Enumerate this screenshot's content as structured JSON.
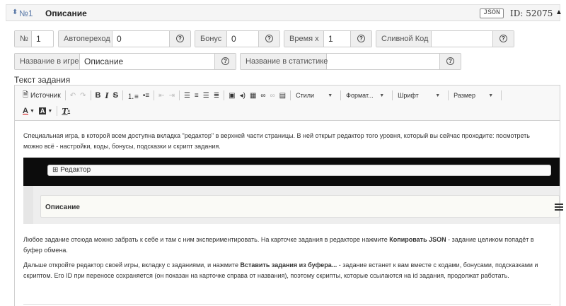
{
  "header": {
    "sort_icon": "sort-icon",
    "number": "№1",
    "title": "Описание",
    "json_badge": "JSON",
    "id_text": "ID: 52075",
    "collapse_icon": "▲"
  },
  "fields": {
    "number": {
      "label": "№",
      "value": "1"
    },
    "autotransition": {
      "label": "Автопереход",
      "value": "0"
    },
    "bonus": {
      "label": "Бонус",
      "value": "0"
    },
    "time": {
      "label": "Время х",
      "value": "1"
    },
    "drain_code": {
      "label": "Сливной Код",
      "value": ""
    },
    "game_name": {
      "label": "Название в игре",
      "value": "Описание"
    },
    "stats_name": {
      "label": "Название в статистике",
      "value": ""
    },
    "help_icon": "?"
  },
  "task_label": "Текст задания",
  "toolbar": {
    "source": "Источник",
    "styles": "Стили",
    "format": "Формат...",
    "font": "Шрифт",
    "size": "Размер"
  },
  "content": {
    "p1": "Специальная игра, в которой всем доступна вкладка \"редактор\" в верхней части страницы. В ней открыт редактор того уровня, который вы сейчас проходите: посмотреть можно всё - настройки, коды, бонусы, подсказки и скрипт задания.",
    "shot_editor": "⊞ Редактор",
    "shot_card_title": "Описание",
    "p2_a": "Любое задание отсюда можно забрать к себе и там с ним экспериментировать. На карточке задания в редакторе нажмите ",
    "p2_b": "Копировать JSON",
    "p2_c": " - задание целиком попадёт в буфер обмена.",
    "p3_a": "Дальше откройте редактор своей игры, вкладку с заданиями, и нажмите ",
    "p3_b": "Вставить задания из буфера...",
    "p3_c": " - задание встанет к вам вместе с кодами, бонусами, подсказками и скриптом. Его ID при переносе сохраняется (он показан на карточке справа от названия), поэтому скрипты, которые ссылаются на id задания, продолжат работать."
  }
}
